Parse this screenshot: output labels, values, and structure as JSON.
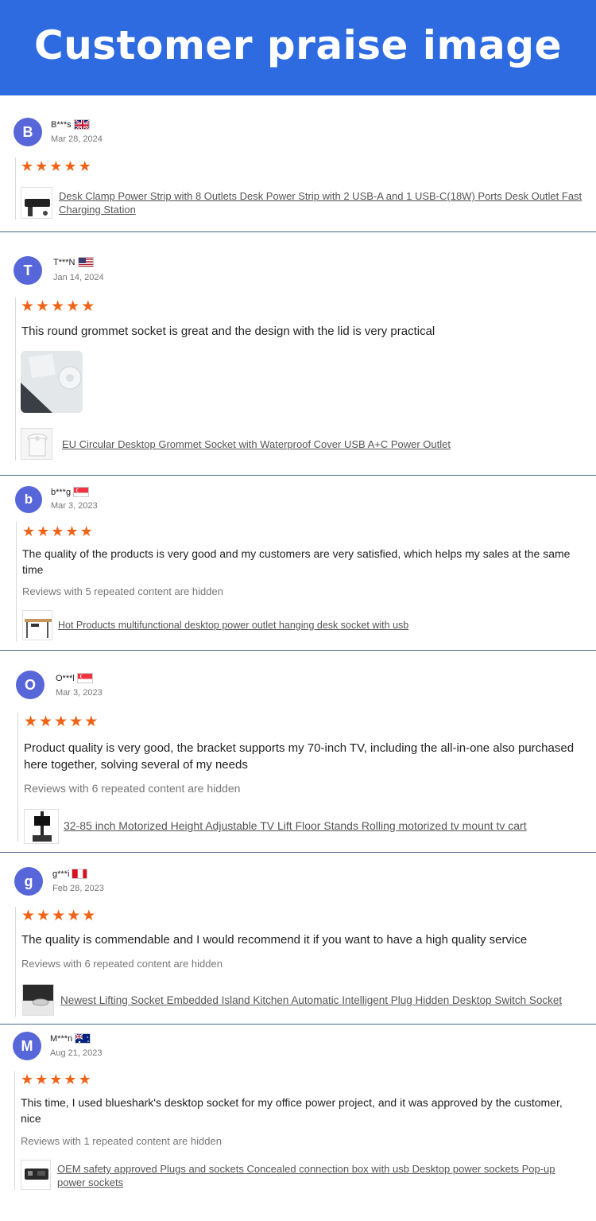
{
  "header": {
    "title": "Customer praise image"
  },
  "colors": {
    "banner": "#2f6be0",
    "avatar": "#5766d9",
    "star": "#f06317"
  },
  "star_glyph": "★",
  "reviews": [
    {
      "initial": "B",
      "user": "B***s",
      "flag": "united-kingdom-flag",
      "date": "Mar 28, 2024",
      "rating": 5,
      "text": "",
      "hidden_note": "",
      "product": "Desk Clamp Power Strip with 8 Outlets Desk Power Strip with 2 USB-A and 1 USB-C(18W) Ports Desk Outlet Fast Charging Station"
    },
    {
      "initial": "T",
      "user": "T***N",
      "flag": "united-states-flag",
      "date": "Jan 14, 2024",
      "rating": 5,
      "text": "This round grommet socket is great and the design with the lid is very practical",
      "hidden_note": "",
      "product": "EU Circular Desktop Grommet Socket with Waterproof Cover USB A+C Power Outlet"
    },
    {
      "initial": "b",
      "user": "b***g",
      "flag": "singapore-flag",
      "date": "Mar 3, 2023",
      "rating": 5,
      "text": "The quality of the products is very good and my customers are very satisfied, which helps my sales at the same time",
      "hidden_note": "Reviews with 5 repeated content are hidden",
      "product": "Hot Products multifunctional desktop power outlet hanging desk socket with usb"
    },
    {
      "initial": "O",
      "user": "O***l",
      "flag": "singapore-flag",
      "date": "Mar 3, 2023",
      "rating": 5,
      "text": "Product quality is very good, the bracket supports my 70-inch TV, including the all-in-one also purchased here together, solving several of my needs",
      "hidden_note": "Reviews with 6 repeated content are hidden",
      "product": "32-85 inch Motorized Height Adjustable TV Lift Floor Stands Rolling motorized tv mount tv cart"
    },
    {
      "initial": "g",
      "user": "g***i",
      "flag": "peru-flag",
      "date": "Feb 28, 2023",
      "rating": 5,
      "text": "The quality is commendable and I would recommend it if you want to have a high quality service",
      "hidden_note": "Reviews with 6 repeated content are hidden",
      "product": "Newest Lifting Socket Embedded Island Kitchen Automatic Intelligent Plug Hidden Desktop Switch Socket"
    },
    {
      "initial": "M",
      "user": "M***n",
      "flag": "australia-flag",
      "date": "Aug 21, 2023",
      "rating": 5,
      "text": "This time, I used blueshark's desktop socket for my office power project, and it was approved by the customer, nice",
      "hidden_note": "Reviews with 1 repeated content are hidden",
      "product": "OEM safety approved Plugs and sockets Concealed connection box with usb Desktop power sockets Pop-up power sockets"
    }
  ]
}
